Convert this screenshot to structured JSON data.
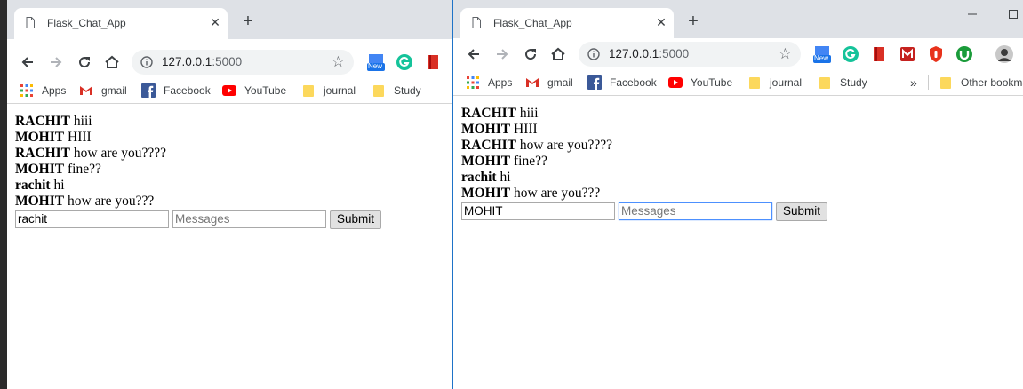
{
  "browser": {
    "tab_title": "Flask_Chat_App",
    "new_tab_symbol": "+",
    "url_host": "127.0.0.1",
    "url_port": ":5000",
    "extension_new_badge": "New"
  },
  "bookmarks": {
    "apps": "Apps",
    "gmail": "gmail",
    "facebook": "Facebook",
    "youtube": "YouTube",
    "journal": "journal",
    "study": "Study",
    "more": "»",
    "other": "Other bookma"
  },
  "left_window": {
    "messages": [
      {
        "user": "RACHIT",
        "text": "hiii"
      },
      {
        "user": "MOHIT",
        "text": "HIII"
      },
      {
        "user": "RACHIT",
        "text": "how are you????"
      },
      {
        "user": "MOHIT",
        "text": "fine??"
      },
      {
        "user": "rachit",
        "text": "hi"
      },
      {
        "user": "MOHIT",
        "text": "how are you???"
      }
    ],
    "username_value": "rachit",
    "message_placeholder": "Messages",
    "submit_label": "Submit"
  },
  "right_window": {
    "messages": [
      {
        "user": "RACHIT",
        "text": "hiii"
      },
      {
        "user": "MOHIT",
        "text": "HIII"
      },
      {
        "user": "RACHIT",
        "text": "how are you????"
      },
      {
        "user": "MOHIT",
        "text": "fine??"
      },
      {
        "user": "rachit",
        "text": "hi"
      },
      {
        "user": "MOHIT",
        "text": "how are you???"
      }
    ],
    "username_value": "MOHIT",
    "message_placeholder": "Messages",
    "submit_label": "Submit"
  },
  "colors": {
    "tabstrip": "#dee1e6",
    "omnibox": "#f1f3f4",
    "focus_border": "#4d90fe",
    "folder": "#fcd85c"
  }
}
